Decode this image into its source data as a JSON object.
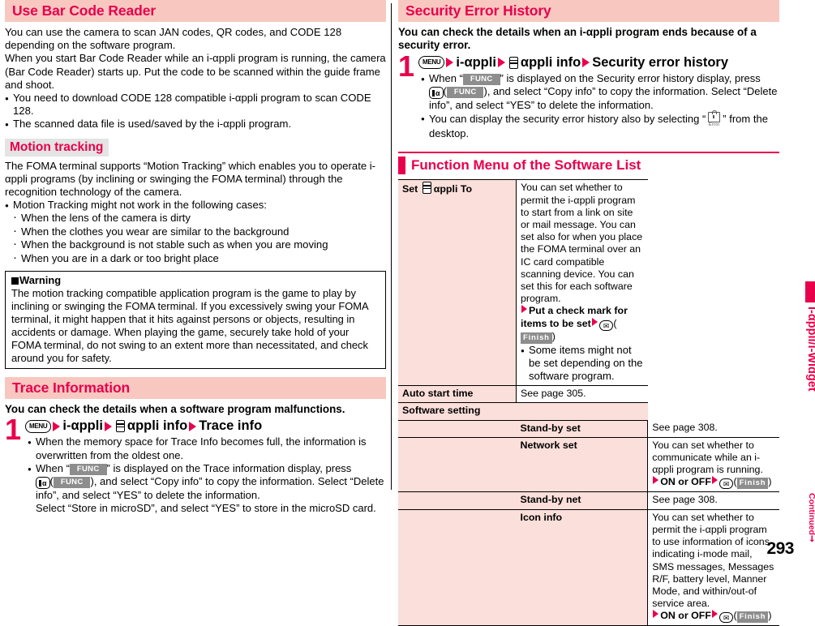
{
  "page": {
    "number": "293",
    "side_label": "i-αppli/i-Widget",
    "continued_label": "Continued"
  },
  "left": {
    "section1": {
      "heading": "Use Bar Code Reader",
      "paragraphs": [
        "You can use the camera to scan JAN codes, QR codes, and CODE 128 depending on the software program.",
        "When you start Bar Code Reader while an i-αppli program is running, the camera (Bar Code Reader) starts up. Put the code to be scanned within the guide frame and shoot."
      ],
      "bullets": [
        "You need to download CODE 128 compatible i-αppli program to scan CODE 128.",
        "The scanned data file is used/saved by the i-αppli program."
      ]
    },
    "section2": {
      "heading": "Motion tracking",
      "paragraph": "The FOMA terminal supports “Motion Tracking” which enables you to operate i-αppli programs (by inclining or swinging the FOMA terminal) through the recognition technology of the camera.",
      "bullet": "Motion Tracking might not work in the following cases:",
      "subitems": [
        "When the lens of the camera is dirty",
        "When the clothes you wear are similar to the background",
        "When the background is not stable such as when you are moving",
        "When you are in a dark or too bright place"
      ],
      "warning": {
        "title": "Warning",
        "text": "The motion tracking compatible application program is the game to play by inclining or swinging the FOMA terminal. If you excessively swing your FOMA terminal, it might happen that it hits against persons or objects, resulting in accidents or damage. When playing the game, securely take hold of your FOMA terminal, do not swing to an extent more than necessitated, and check around you for safety."
      }
    },
    "section3": {
      "heading": "Trace Information",
      "lead": "You can check the details when a software program malfunctions.",
      "step_number": "1",
      "step_keys": {
        "menu": "MENU",
        "item1": "i-αppli",
        "phone_icon": "phone-key-icon",
        "item2": "αppli info",
        "item3": "Trace info"
      },
      "bullets": [
        "When the memory space for Trace Info becomes full, the information is overwritten from the oldest one."
      ],
      "note_prefix": "When “",
      "note_func": "FUNC",
      "note_mid": "” is displayed on the Trace information display, press",
      "note_line2_pre": "(",
      "note_line2_post": "), and select “Copy info” to copy the information. Select “Delete info”, and select “YES” to delete the information.",
      "note_line3": "Select “Store in microSD”, and select “YES” to store in the microSD card."
    }
  },
  "right": {
    "section1": {
      "heading": "Security Error History",
      "lead": "You can check the details when an i-αppli program ends because of a security error.",
      "step_number": "1",
      "step_keys": {
        "menu": "MENU",
        "item1": "i-αppli",
        "phone_icon": "phone-key-icon",
        "item2": "αppli info",
        "item3": "Security error history"
      },
      "note_prefix": "When “",
      "note_func": "FUNC",
      "note_mid": "” is displayed on the Security error history display, press",
      "note_line2_post": "), and select “Copy info” to copy the information. Select “Delete info”, and select “YES” to delete the information.",
      "bullet2_pre": "You can display the security error history also by selecting “",
      "bullet2_icon_label": "Error",
      "bullet2_post": "” from the desktop."
    },
    "section2": {
      "heading": "Function Menu of the Software List",
      "rows": [
        {
          "label": "Set",
          "label_icon": "phone-key-icon",
          "label_suffix": "αppli To",
          "desc_paragraph": "You can set whether to permit the i-αppli program to start from a link on site or mail message. You can set also for when you place the FOMA terminal over an IC card compatible scanning device. You can set this for each software program.",
          "desc_action": "Put a check mark for items to be set",
          "desc_action_btn": "Finish",
          "desc_bullet": "Some items might not be set depending on the software program."
        },
        {
          "label": "Auto start time",
          "desc_paragraph": "See page 305."
        },
        {
          "label": "Software setting",
          "is_group": true
        },
        {
          "label": "Stand-by set",
          "indent": true,
          "desc_paragraph": "See page 308."
        },
        {
          "label": "Network set",
          "indent": true,
          "desc_paragraph": "You can set whether to communicate while an i-αppli program is running.",
          "desc_action": "ON or OFF",
          "desc_action_btn": "Finish"
        },
        {
          "label": "Stand-by net",
          "indent": true,
          "desc_paragraph": "See page 308."
        },
        {
          "label": "Icon info",
          "indent": true,
          "desc_paragraph": "You can set whether to permit the i-αppli program to use information of icons indicating i-mode mail, SMS messages, Messages R/F, battery level, Manner Mode, and within/out-of service area.",
          "desc_action": "ON or OFF",
          "desc_action_btn": "Finish"
        }
      ]
    }
  }
}
